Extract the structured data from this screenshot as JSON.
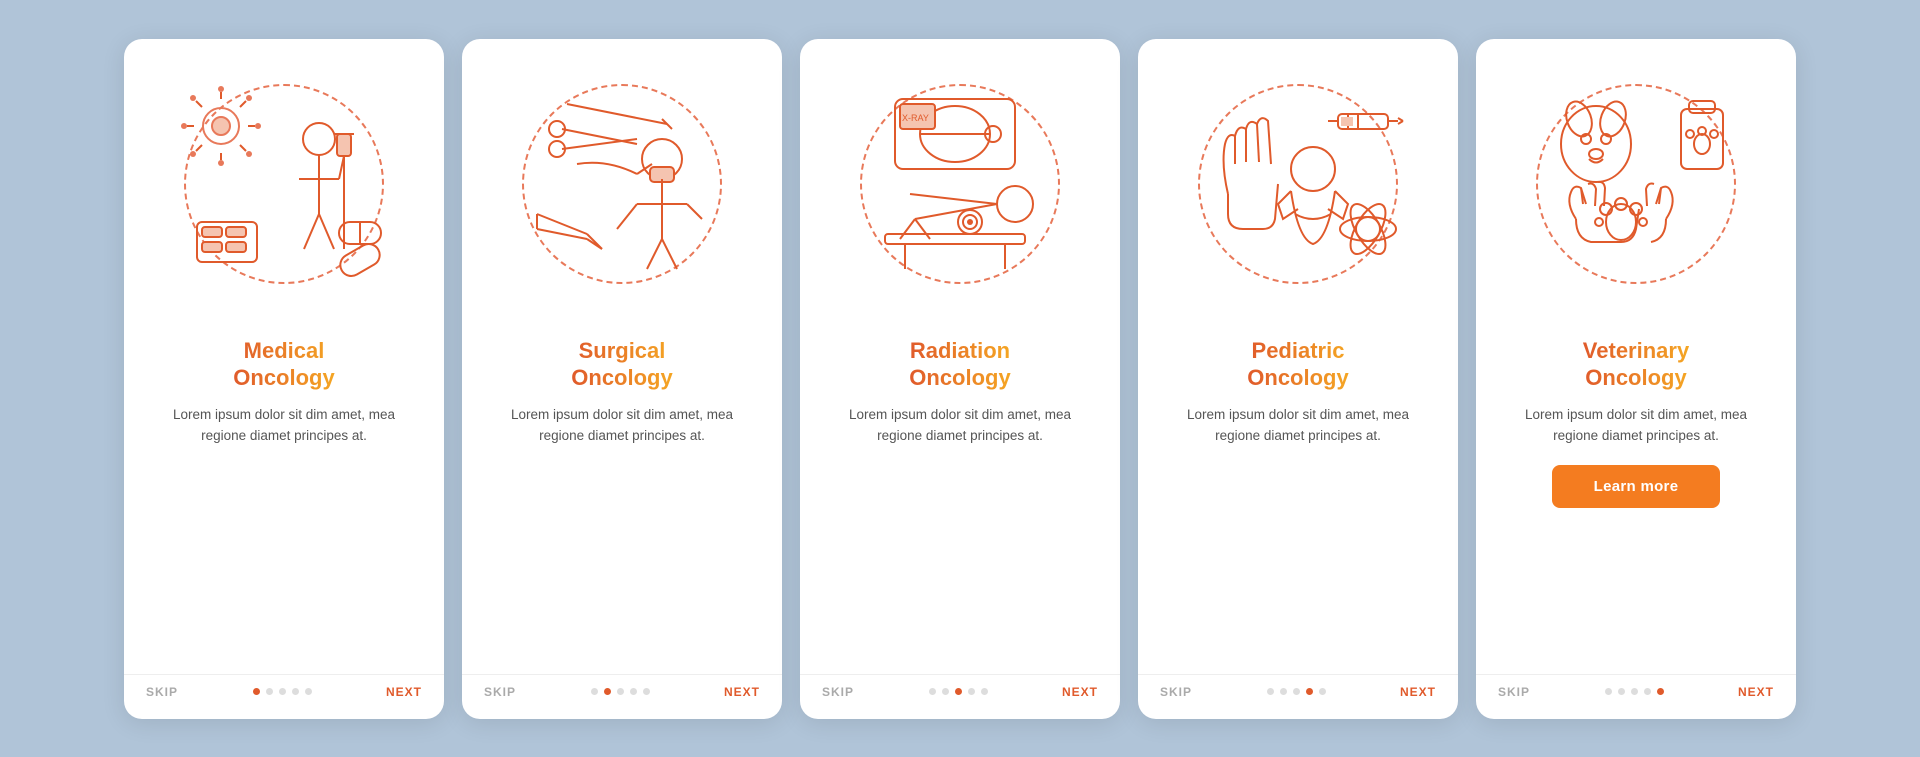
{
  "background_color": "#b0c4d8",
  "cards": [
    {
      "id": "medical-oncology",
      "title": "Medical\nOncology",
      "body": "Lorem ipsum dolor sit dim amet, mea regione diamet principes at.",
      "skip_label": "SKIP",
      "next_label": "NEXT",
      "dots": [
        true,
        false,
        false,
        false,
        false
      ],
      "active_dot": 0,
      "show_learn_more": false,
      "learn_more_label": ""
    },
    {
      "id": "surgical-oncology",
      "title": "Surgical\nOncology",
      "body": "Lorem ipsum dolor sit dim amet, mea regione diamet principes at.",
      "skip_label": "SKIP",
      "next_label": "NEXT",
      "dots": [
        false,
        true,
        false,
        false,
        false
      ],
      "active_dot": 1,
      "show_learn_more": false,
      "learn_more_label": ""
    },
    {
      "id": "radiation-oncology",
      "title": "Radiation\nOncology",
      "body": "Lorem ipsum dolor sit dim amet, mea regione diamet principes at.",
      "skip_label": "SKIP",
      "next_label": "NEXT",
      "dots": [
        false,
        false,
        true,
        false,
        false
      ],
      "active_dot": 2,
      "show_learn_more": false,
      "learn_more_label": ""
    },
    {
      "id": "pediatric-oncology",
      "title": "Pediatric\nOncology",
      "body": "Lorem ipsum dolor sit dim amet, mea regione diamet principes at.",
      "skip_label": "SKIP",
      "next_label": "NEXT",
      "dots": [
        false,
        false,
        false,
        true,
        false
      ],
      "active_dot": 3,
      "show_learn_more": false,
      "learn_more_label": ""
    },
    {
      "id": "veterinary-oncology",
      "title": "Veterinary\nOncology",
      "body": "Lorem ipsum dolor sit dim amet, mea regione diamet principes at.",
      "skip_label": "SKIP",
      "next_label": "NEXT",
      "dots": [
        false,
        false,
        false,
        false,
        true
      ],
      "active_dot": 4,
      "show_learn_more": true,
      "learn_more_label": "Learn more"
    }
  ]
}
